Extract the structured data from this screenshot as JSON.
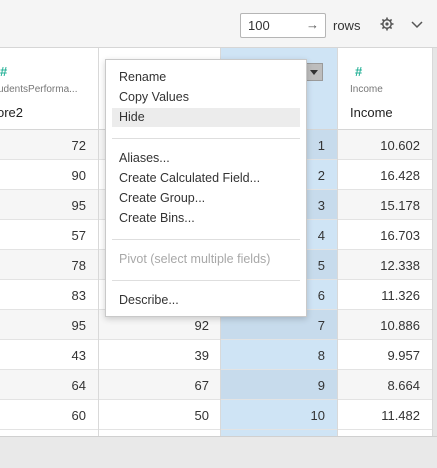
{
  "toolbar": {
    "rows_value": "100",
    "go_arrow": "→",
    "rows_label": "rows",
    "settings_icon": "gear-icon",
    "expand_icon": "chevron-down-icon"
  },
  "columns": [
    {
      "type_icon": "#",
      "source": "udentsPerforma...",
      "name": "ore2"
    },
    {
      "type_icon": "",
      "source": "",
      "name": ""
    },
    {
      "type_icon": "",
      "source": "",
      "name": ""
    },
    {
      "type_icon": "#",
      "source": "Income",
      "name": "Income"
    }
  ],
  "rows": [
    {
      "a": "72",
      "b": "",
      "c": "1",
      "d": "10.602"
    },
    {
      "a": "90",
      "b": "",
      "c": "2",
      "d": "16.428"
    },
    {
      "a": "95",
      "b": "",
      "c": "3",
      "d": "15.178"
    },
    {
      "a": "57",
      "b": "",
      "c": "4",
      "d": "16.703"
    },
    {
      "a": "78",
      "b": "",
      "c": "5",
      "d": "12.338"
    },
    {
      "a": "83",
      "b": "",
      "c": "6",
      "d": "11.326"
    },
    {
      "a": "95",
      "b": "92",
      "c": "7",
      "d": "10.886"
    },
    {
      "a": "43",
      "b": "39",
      "c": "8",
      "d": "9.957"
    },
    {
      "a": "64",
      "b": "67",
      "c": "9",
      "d": "8.664"
    },
    {
      "a": "60",
      "b": "50",
      "c": "10",
      "d": "11.482"
    }
  ],
  "menu": {
    "items": [
      {
        "label": "Rename"
      },
      {
        "label": "Copy Values"
      },
      {
        "label": "Hide"
      },
      {
        "label": "Aliases..."
      },
      {
        "label": "Create Calculated Field..."
      },
      {
        "label": "Create Group..."
      },
      {
        "label": "Create Bins..."
      },
      {
        "label": "Pivot (select multiple fields)"
      },
      {
        "label": "Describe..."
      }
    ]
  },
  "colors": {
    "accent_green": "#2bb39a",
    "selected_column": "#cfe4f5"
  }
}
